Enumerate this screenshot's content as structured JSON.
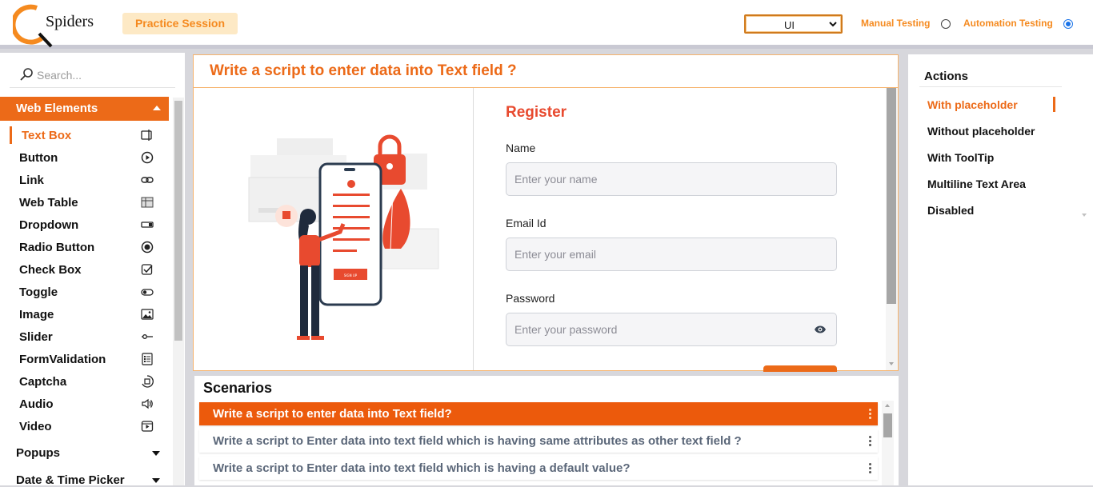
{
  "header": {
    "logo_text": "Spiders",
    "practice_label": "Practice Session",
    "select_value": "UI",
    "radio_manual": "Manual Testing",
    "radio_automation": "Automation Testing"
  },
  "sidebar": {
    "search_placeholder": "Search...",
    "section_title": "Web Elements",
    "items": [
      {
        "label": "Text Box",
        "icon": "textbox-icon"
      },
      {
        "label": "Button",
        "icon": "play-circle-icon"
      },
      {
        "label": "Link",
        "icon": "link-icon"
      },
      {
        "label": "Web Table",
        "icon": "table-icon"
      },
      {
        "label": "Dropdown",
        "icon": "dropdown-icon"
      },
      {
        "label": "Radio Button",
        "icon": "radio-icon"
      },
      {
        "label": "Check Box",
        "icon": "checkbox-icon"
      },
      {
        "label": "Toggle",
        "icon": "toggle-icon"
      },
      {
        "label": "Image",
        "icon": "image-icon"
      },
      {
        "label": "Slider",
        "icon": "slider-icon"
      },
      {
        "label": "FormValidation",
        "icon": "form-icon"
      },
      {
        "label": "Captcha",
        "icon": "captcha-icon"
      },
      {
        "label": "Audio",
        "icon": "audio-icon"
      },
      {
        "label": "Video",
        "icon": "video-icon"
      }
    ],
    "popups": "Popups",
    "datetime": "Date & Time Picker"
  },
  "main": {
    "title": "Write a script to enter data into Text field ?",
    "register": "Register",
    "fields": [
      {
        "label": "Name",
        "placeholder": "Enter your name"
      },
      {
        "label": "Email Id",
        "placeholder": "Enter your email"
      },
      {
        "label": "Password",
        "placeholder": "Enter your password"
      }
    ],
    "illus_button": "SIGN UP"
  },
  "scenarios": {
    "title": "Scenarios",
    "items": [
      "Write a script to enter data into Text field?",
      "Write a script to Enter data into text field which is having same attributes as other text field ?",
      "Write a script to Enter data into text field which is having a default value?"
    ]
  },
  "actions": {
    "title": "Actions",
    "items": [
      "With placeholder",
      "Without placeholder",
      "With ToolTip",
      "Multiline Text Area",
      "Disabled"
    ]
  },
  "colors": {
    "accent": "#ec6a18",
    "brand_light": "#fde9c5",
    "radio_on": "#1a73e8"
  }
}
